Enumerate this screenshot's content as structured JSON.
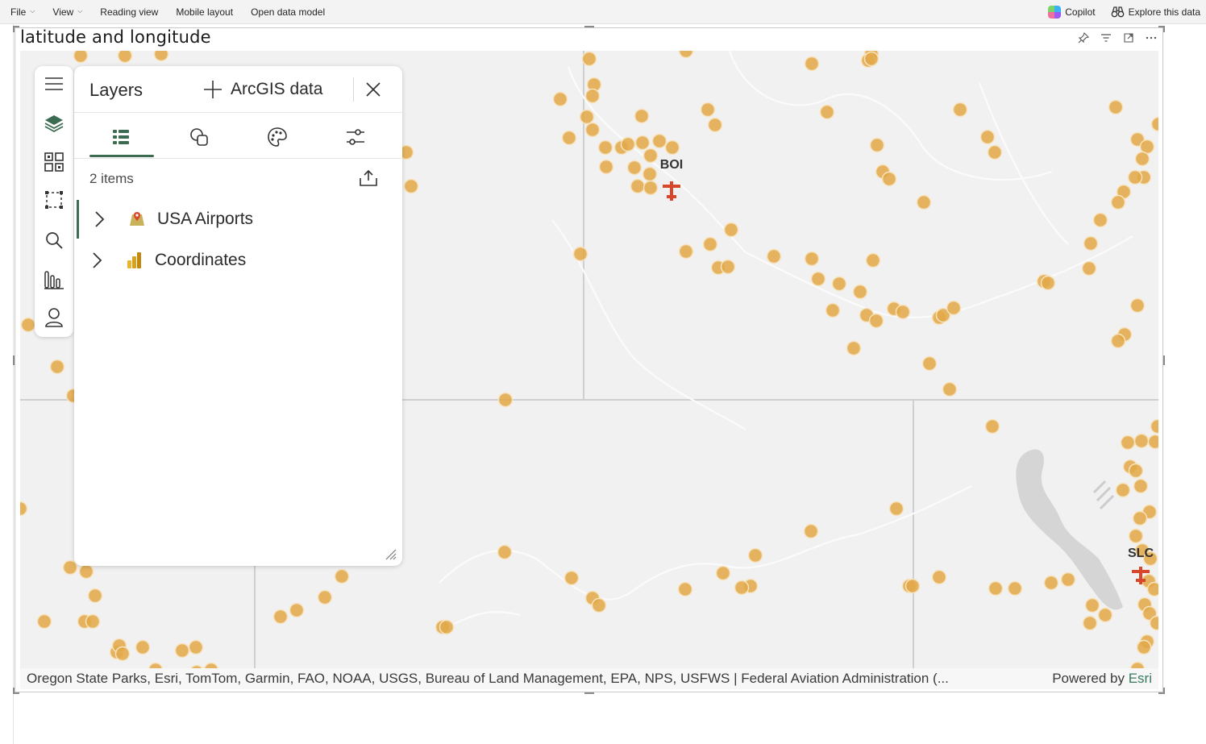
{
  "menu": {
    "file": "File",
    "view": "View",
    "reading_view": "Reading view",
    "mobile_layout": "Mobile layout",
    "open_data_model": "Open data model",
    "copilot": "Copilot",
    "explore": "Explore this data"
  },
  "visual": {
    "title": "latitude and longitude",
    "icons": [
      "pin-icon",
      "filter-icon",
      "focus-mode-icon",
      "more-options-icon"
    ]
  },
  "map": {
    "airport_labels": [
      "BOI",
      "SLC"
    ],
    "point_color": "#e3a84a",
    "airport_color": "#d9472b",
    "attribution": "Oregon State Parks, Esri, TomTom, Garmin, FAO, NOAA, USGS, Bureau of Land Management, EPA, NPS, USFWS | Federal Aviation Administration (...",
    "powered_by": "Powered by",
    "powered_by_brand": "Esri"
  },
  "toolbar": {
    "tools": [
      "menu-icon",
      "layers-icon",
      "basemap-icon",
      "select-icon",
      "search-icon",
      "analytics-icon",
      "user-icon"
    ]
  },
  "layers_panel": {
    "title": "Layers",
    "add_label": "ArcGIS data",
    "tabs": [
      "layer-list-tab",
      "layer-shapes-tab",
      "symbology-tab",
      "settings-tab"
    ],
    "items_count": "2 items",
    "layers": [
      {
        "name": "USA Airports",
        "icon": "arcgis-layer-icon"
      },
      {
        "name": "Coordinates",
        "icon": "powerbi-layer-icon"
      }
    ],
    "accent": "#3b6b50"
  }
}
